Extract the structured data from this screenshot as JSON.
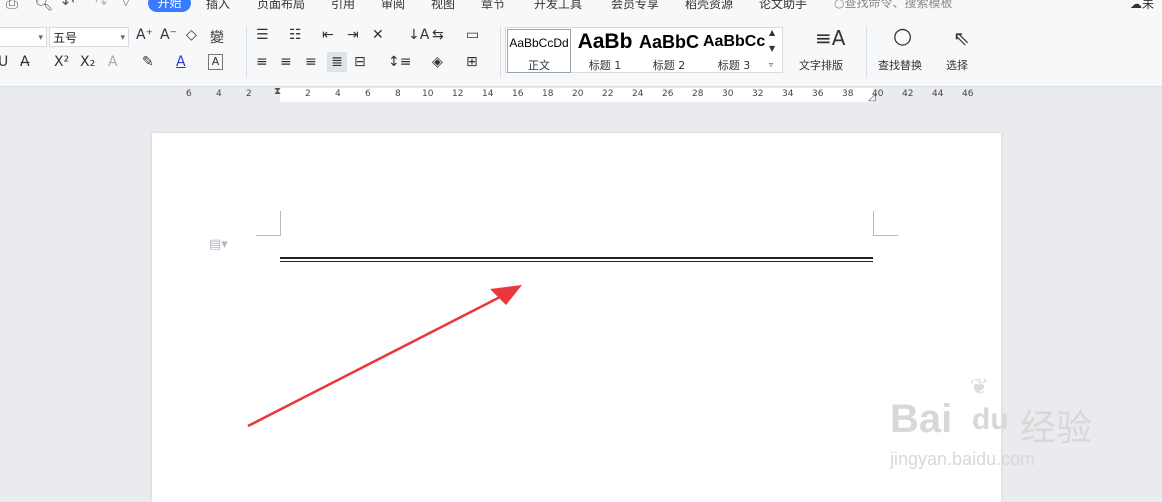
{
  "menu": {
    "tabs": [
      "开始",
      "插入",
      "页面布局",
      "引用",
      "审阅",
      "视图",
      "章节",
      "开发工具",
      "会员专享",
      "稻壳资源",
      "论文助手"
    ],
    "search_placeholder": "查找命令、搜索模板",
    "right_text": "未"
  },
  "font": {
    "size_value": "五号"
  },
  "styles": [
    {
      "sample": "AaBbCcDd",
      "label": "正文"
    },
    {
      "sample": "AaBb",
      "label": "标题 1"
    },
    {
      "sample": "AaBbC",
      "label": "标题 2"
    },
    {
      "sample": "AaBbCc",
      "label": "标题 3"
    }
  ],
  "ribbon_buttons": {
    "text_layout": "文字排版",
    "find_replace": "查找替换",
    "select": "选择"
  },
  "ruler_ticks": [
    "6",
    "4",
    "2",
    "2",
    "4",
    "6",
    "8",
    "10",
    "12",
    "14",
    "16",
    "18",
    "20",
    "22",
    "24",
    "26",
    "28",
    "30",
    "32",
    "34",
    "36",
    "38",
    "40",
    "42",
    "44",
    "46"
  ],
  "watermark": {
    "brand": "Bai",
    "brand2": "du",
    "brand_cn": "经验",
    "url": "jingyan.baidu.com"
  },
  "colors": {
    "accent": "#3a7afe",
    "arrow": "#e8383d"
  }
}
